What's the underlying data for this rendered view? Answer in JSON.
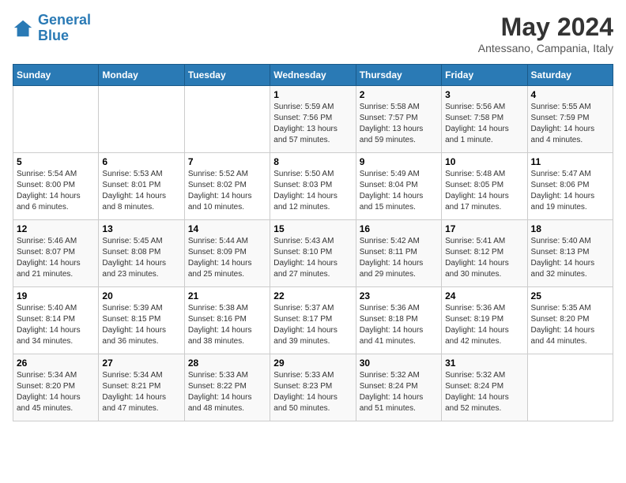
{
  "logo": {
    "line1": "General",
    "line2": "Blue"
  },
  "title": "May 2024",
  "subtitle": "Antessano, Campania, Italy",
  "days_of_week": [
    "Sunday",
    "Monday",
    "Tuesday",
    "Wednesday",
    "Thursday",
    "Friday",
    "Saturday"
  ],
  "weeks": [
    [
      {
        "day": "",
        "info": ""
      },
      {
        "day": "",
        "info": ""
      },
      {
        "day": "",
        "info": ""
      },
      {
        "day": "1",
        "info": "Sunrise: 5:59 AM\nSunset: 7:56 PM\nDaylight: 13 hours\nand 57 minutes."
      },
      {
        "day": "2",
        "info": "Sunrise: 5:58 AM\nSunset: 7:57 PM\nDaylight: 13 hours\nand 59 minutes."
      },
      {
        "day": "3",
        "info": "Sunrise: 5:56 AM\nSunset: 7:58 PM\nDaylight: 14 hours\nand 1 minute."
      },
      {
        "day": "4",
        "info": "Sunrise: 5:55 AM\nSunset: 7:59 PM\nDaylight: 14 hours\nand 4 minutes."
      }
    ],
    [
      {
        "day": "5",
        "info": "Sunrise: 5:54 AM\nSunset: 8:00 PM\nDaylight: 14 hours\nand 6 minutes."
      },
      {
        "day": "6",
        "info": "Sunrise: 5:53 AM\nSunset: 8:01 PM\nDaylight: 14 hours\nand 8 minutes."
      },
      {
        "day": "7",
        "info": "Sunrise: 5:52 AM\nSunset: 8:02 PM\nDaylight: 14 hours\nand 10 minutes."
      },
      {
        "day": "8",
        "info": "Sunrise: 5:50 AM\nSunset: 8:03 PM\nDaylight: 14 hours\nand 12 minutes."
      },
      {
        "day": "9",
        "info": "Sunrise: 5:49 AM\nSunset: 8:04 PM\nDaylight: 14 hours\nand 15 minutes."
      },
      {
        "day": "10",
        "info": "Sunrise: 5:48 AM\nSunset: 8:05 PM\nDaylight: 14 hours\nand 17 minutes."
      },
      {
        "day": "11",
        "info": "Sunrise: 5:47 AM\nSunset: 8:06 PM\nDaylight: 14 hours\nand 19 minutes."
      }
    ],
    [
      {
        "day": "12",
        "info": "Sunrise: 5:46 AM\nSunset: 8:07 PM\nDaylight: 14 hours\nand 21 minutes."
      },
      {
        "day": "13",
        "info": "Sunrise: 5:45 AM\nSunset: 8:08 PM\nDaylight: 14 hours\nand 23 minutes."
      },
      {
        "day": "14",
        "info": "Sunrise: 5:44 AM\nSunset: 8:09 PM\nDaylight: 14 hours\nand 25 minutes."
      },
      {
        "day": "15",
        "info": "Sunrise: 5:43 AM\nSunset: 8:10 PM\nDaylight: 14 hours\nand 27 minutes."
      },
      {
        "day": "16",
        "info": "Sunrise: 5:42 AM\nSunset: 8:11 PM\nDaylight: 14 hours\nand 29 minutes."
      },
      {
        "day": "17",
        "info": "Sunrise: 5:41 AM\nSunset: 8:12 PM\nDaylight: 14 hours\nand 30 minutes."
      },
      {
        "day": "18",
        "info": "Sunrise: 5:40 AM\nSunset: 8:13 PM\nDaylight: 14 hours\nand 32 minutes."
      }
    ],
    [
      {
        "day": "19",
        "info": "Sunrise: 5:40 AM\nSunset: 8:14 PM\nDaylight: 14 hours\nand 34 minutes."
      },
      {
        "day": "20",
        "info": "Sunrise: 5:39 AM\nSunset: 8:15 PM\nDaylight: 14 hours\nand 36 minutes."
      },
      {
        "day": "21",
        "info": "Sunrise: 5:38 AM\nSunset: 8:16 PM\nDaylight: 14 hours\nand 38 minutes."
      },
      {
        "day": "22",
        "info": "Sunrise: 5:37 AM\nSunset: 8:17 PM\nDaylight: 14 hours\nand 39 minutes."
      },
      {
        "day": "23",
        "info": "Sunrise: 5:36 AM\nSunset: 8:18 PM\nDaylight: 14 hours\nand 41 minutes."
      },
      {
        "day": "24",
        "info": "Sunrise: 5:36 AM\nSunset: 8:19 PM\nDaylight: 14 hours\nand 42 minutes."
      },
      {
        "day": "25",
        "info": "Sunrise: 5:35 AM\nSunset: 8:20 PM\nDaylight: 14 hours\nand 44 minutes."
      }
    ],
    [
      {
        "day": "26",
        "info": "Sunrise: 5:34 AM\nSunset: 8:20 PM\nDaylight: 14 hours\nand 45 minutes."
      },
      {
        "day": "27",
        "info": "Sunrise: 5:34 AM\nSunset: 8:21 PM\nDaylight: 14 hours\nand 47 minutes."
      },
      {
        "day": "28",
        "info": "Sunrise: 5:33 AM\nSunset: 8:22 PM\nDaylight: 14 hours\nand 48 minutes."
      },
      {
        "day": "29",
        "info": "Sunrise: 5:33 AM\nSunset: 8:23 PM\nDaylight: 14 hours\nand 50 minutes."
      },
      {
        "day": "30",
        "info": "Sunrise: 5:32 AM\nSunset: 8:24 PM\nDaylight: 14 hours\nand 51 minutes."
      },
      {
        "day": "31",
        "info": "Sunrise: 5:32 AM\nSunset: 8:24 PM\nDaylight: 14 hours\nand 52 minutes."
      },
      {
        "day": "",
        "info": ""
      }
    ]
  ]
}
